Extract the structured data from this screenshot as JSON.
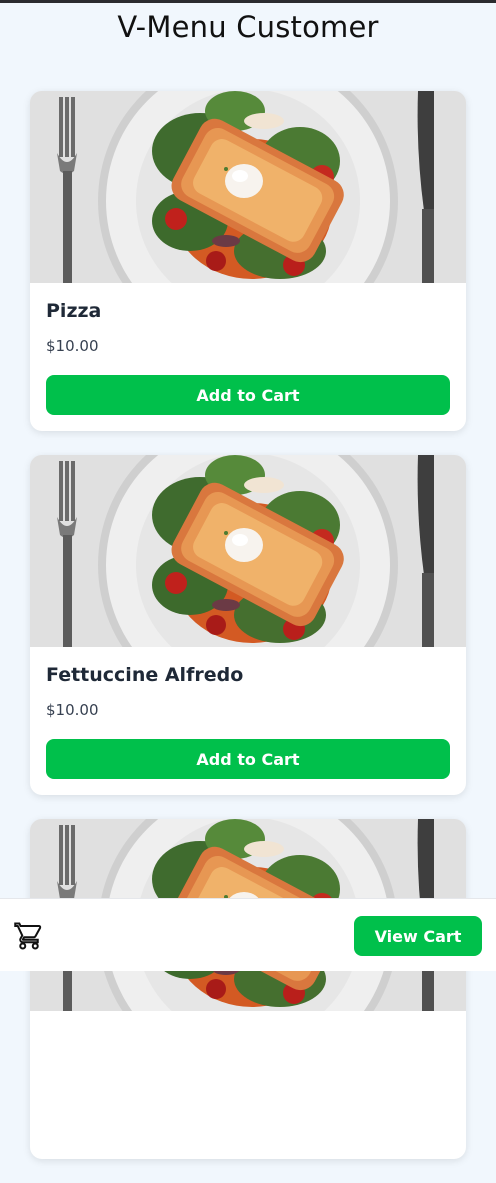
{
  "app": {
    "title": "V-Menu Customer"
  },
  "menu_items": [
    {
      "name": "Pizza",
      "price": "$10.00",
      "button_label": "Add to Cart",
      "image": "plated-dish-photo"
    },
    {
      "name": "Fettuccine Alfredo",
      "price": "$10.00",
      "button_label": "Add to Cart",
      "image": "plated-dish-photo"
    },
    {
      "name": "",
      "price": "",
      "button_label": "",
      "image": "plated-dish-photo"
    }
  ],
  "bottom_bar": {
    "cart_icon": "shopping-cart-icon",
    "view_cart_label": "View Cart"
  },
  "colors": {
    "accent": "#00c04b",
    "background": "#f1f7fd",
    "card": "#ffffff",
    "title_text": "#111111"
  }
}
